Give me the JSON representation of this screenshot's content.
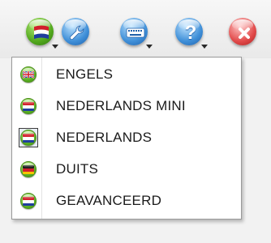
{
  "toolbar": {
    "buttons": [
      {
        "name": "language-flag-button",
        "icon": "netherlands-flag-icon",
        "color": "#52a81d"
      },
      {
        "name": "tools-button",
        "icon": "wrench-icon",
        "color": "#3f8fd8"
      },
      {
        "name": "keyboard-button",
        "icon": "keyboard-icon",
        "color": "#3f8fd8"
      },
      {
        "name": "help-button",
        "icon": "question-mark-icon",
        "color": "#3f8fd8"
      },
      {
        "name": "close-button",
        "icon": "close-icon",
        "color": "#e24b4b"
      }
    ]
  },
  "language_menu": {
    "items": [
      {
        "label": "ENGELS",
        "icon": "uk-flag-icon"
      },
      {
        "label": "NEDERLANDS MINI",
        "icon": "netherlands-flag-icon"
      },
      {
        "label": "NEDERLANDS",
        "icon": "netherlands-flag-icon",
        "selected": true
      },
      {
        "label": "DUITS",
        "icon": "germany-flag-icon"
      },
      {
        "label": "GEAVANCEERD",
        "icon": "netherlands-flag-icon"
      }
    ]
  }
}
